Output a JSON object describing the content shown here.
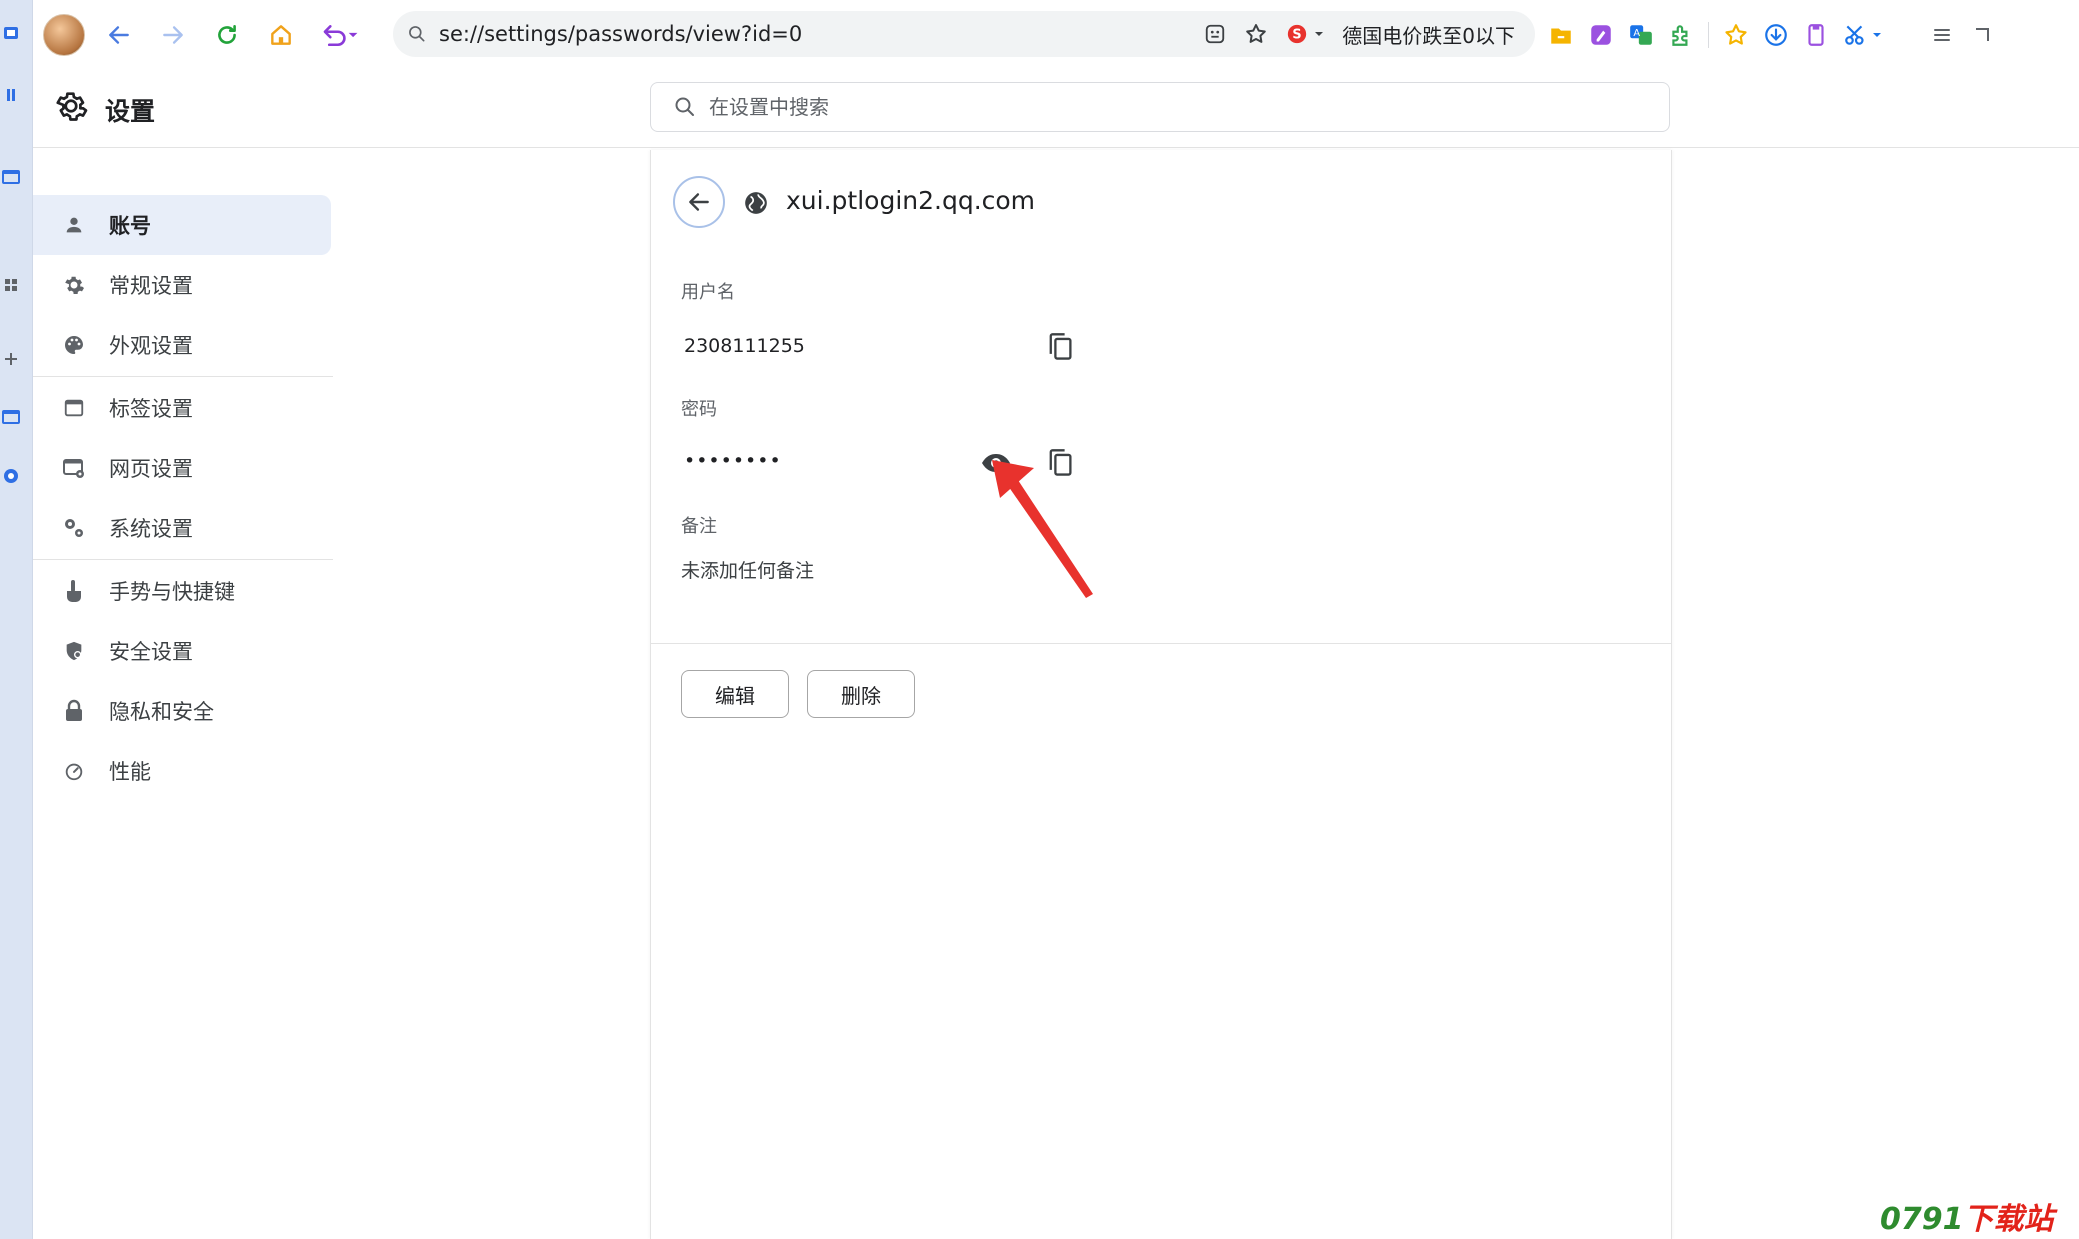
{
  "browser": {
    "address_url": "se://settings/passwords/view?id=0",
    "news_ticker": "德国电价跌至0以下"
  },
  "header": {
    "title": "设置",
    "search_placeholder": "在设置中搜索"
  },
  "nav": {
    "items": [
      {
        "label": "账号",
        "icon": "person-icon",
        "active": true
      },
      {
        "label": "常规设置",
        "icon": "gear-icon"
      },
      {
        "label": "外观设置",
        "icon": "palette-icon"
      },
      {
        "label": "标签设置",
        "icon": "tab-window-icon"
      },
      {
        "label": "网页设置",
        "icon": "webpage-settings-icon"
      },
      {
        "label": "系统设置",
        "icon": "system-gears-icon"
      },
      {
        "label": "手势与快捷键",
        "icon": "hand-pointer-icon"
      },
      {
        "label": "安全设置",
        "icon": "shield-icon"
      },
      {
        "label": "隐私和安全",
        "icon": "lock-icon"
      },
      {
        "label": "性能",
        "icon": "speedometer-icon"
      }
    ]
  },
  "detail": {
    "site": "xui.ptlogin2.qq.com",
    "username_label": "用户名",
    "username_value": "2308111255",
    "password_label": "密码",
    "password_value": "••••••••",
    "note_label": "备注",
    "note_value": "未添加任何备注",
    "edit_label": "编辑",
    "delete_label": "删除"
  },
  "watermark": {
    "green": "0791",
    "red": "下载站"
  },
  "colors": {
    "accent": "#1a73e8",
    "nav_active_bg": "#e8eef9",
    "arrow": "#e8322d"
  }
}
